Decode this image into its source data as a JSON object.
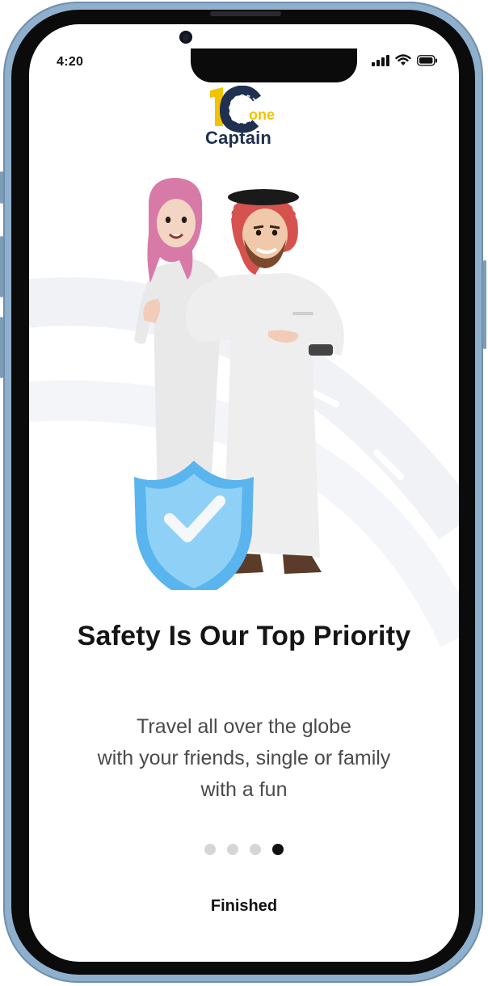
{
  "status_bar": {
    "time": "4:20"
  },
  "logo": {
    "primary": "Captain",
    "accent": "one"
  },
  "onboarding": {
    "title": "Safety Is Our Top Priority",
    "description_lines": [
      "Travel all over the globe",
      "with your friends,  single or family",
      "with a fun"
    ],
    "pages_total": 4,
    "current_page": 4,
    "finish_label": "Finished"
  },
  "colors": {
    "brand_navy": "#1f3050",
    "brand_yellow": "#f2c300",
    "dot_active": "#111111",
    "dot_inactive": "#d6d6d6",
    "shield_blue": "#5ab4ee"
  },
  "icons": [
    "signal-icon",
    "wifi-icon",
    "battery-icon",
    "shield-check-icon"
  ]
}
